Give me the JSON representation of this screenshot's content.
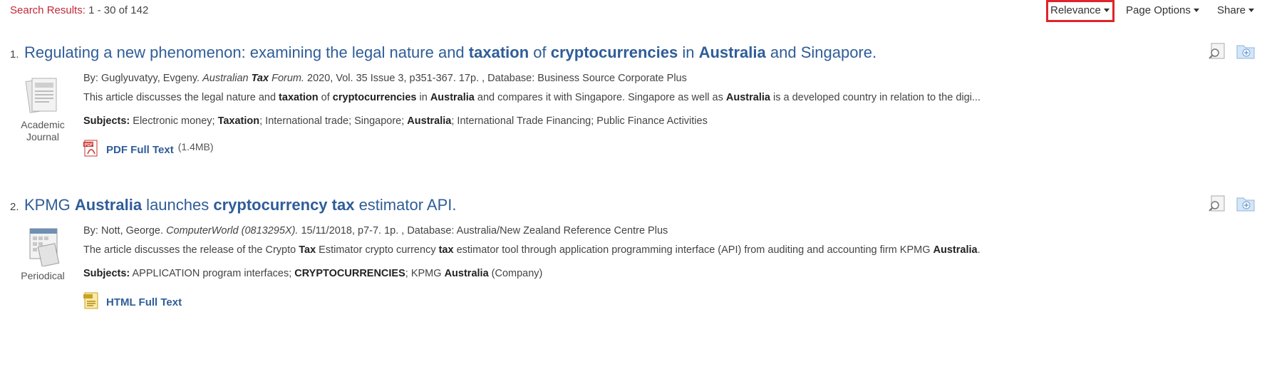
{
  "header": {
    "search_results_label": "Search Results:",
    "search_results_range": "1 - 30 of 142",
    "relevance_label": "Relevance",
    "page_options_label": "Page Options",
    "share_label": "Share"
  },
  "results": [
    {
      "number": "1.",
      "title_parts": [
        "Regulating a new phenomenon: examining the legal nature and ",
        "taxation",
        " of ",
        "cryptocurrencies",
        " in ",
        "Australia",
        " and Singapore."
      ],
      "pub_type": [
        "Academic",
        "Journal"
      ],
      "byline": [
        "By: Guglyuvatyy, Evgeny. ",
        "Australian ",
        "Tax",
        " Forum.",
        " 2020, Vol. 35 Issue 3, p351-367. 17p. , Database: Business Source Corporate Plus"
      ],
      "abstract": [
        "This article discusses the legal nature and ",
        "taxation",
        " of ",
        "cryptocurrencies",
        " in ",
        "Australia",
        " and compares it with Singapore. Singapore as well as ",
        "Australia",
        " is a developed country in relation to the digi..."
      ],
      "subjects_label": "Subjects:",
      "subjects": [
        " Electronic money; ",
        "Taxation",
        "; International trade; Singapore; ",
        "Australia",
        "; International Trade Financing; Public Finance Activities"
      ],
      "link_label": "PDF Full Text",
      "link_size": "(1.4MB)"
    },
    {
      "number": "2.",
      "title_parts": [
        "KPMG ",
        "Australia",
        " launches ",
        "cryptocurrency tax",
        " estimator API."
      ],
      "pub_type": [
        "Periodical"
      ],
      "byline": [
        "By: Nott, George. ",
        "ComputerWorld (0813295X).",
        " 15/11/2018, p7-7. 1p. , Database: Australia/New Zealand Reference Centre Plus"
      ],
      "abstract": [
        "The article discusses the release of the Crypto ",
        "Tax",
        " Estimator crypto currency ",
        "tax",
        " estimator tool through application programming interface (API) from auditing and accounting firm KPMG ",
        "Australia",
        "."
      ],
      "subjects_label": "Subjects:",
      "subjects": [
        " APPLICATION program interfaces; ",
        "CRYPTOCURRENCIES",
        "; KPMG ",
        "Australia",
        " (Company)"
      ],
      "link_label": "HTML Full Text"
    }
  ],
  "icons": [
    "search-results-icon",
    "academic-journal-icon",
    "pdf-icon",
    "preview-magnifier-icon",
    "add-to-folder-icon",
    "periodical-icon",
    "html-fulltext-icon",
    "caret-down-icon"
  ],
  "colors": {
    "link": "#2f5d98",
    "label_red": "#c0283a",
    "highlight_box": "#e0242b"
  }
}
